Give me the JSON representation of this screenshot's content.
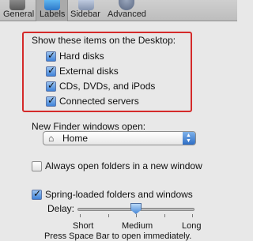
{
  "toolbar": {
    "tabs": [
      {
        "label": "General",
        "icon": "general-icon"
      },
      {
        "label": "Labels",
        "icon": "labels-icon"
      },
      {
        "label": "Sidebar",
        "icon": "sidebar-icon"
      },
      {
        "label": "Advanced",
        "icon": "advanced-gear-icon"
      }
    ],
    "selected": "Labels"
  },
  "desktop_items": {
    "title": "Show these items on the Desktop:",
    "items": [
      {
        "label": "Hard disks",
        "checked": true
      },
      {
        "label": "External disks",
        "checked": true
      },
      {
        "label": "CDs, DVDs, and iPods",
        "checked": true
      },
      {
        "label": "Connected servers",
        "checked": true
      }
    ],
    "highlight_color": "#d42a2a"
  },
  "new_window": {
    "label": "New Finder windows open:",
    "selected_value": "Home",
    "icon": "home-icon"
  },
  "always_open_new_window": {
    "label": "Always open folders in a new window",
    "checked": false
  },
  "spring_loaded": {
    "label": "Spring-loaded folders and windows",
    "checked": true
  },
  "delay": {
    "label": "Delay:",
    "labels": [
      "Short",
      "Medium",
      "Long"
    ],
    "value": "Medium"
  },
  "cut_off_text": "Press Space Bar to open immediately.",
  "colors": {
    "checkbox_accent": "#3f82d8",
    "background": "#e8e8e8"
  }
}
